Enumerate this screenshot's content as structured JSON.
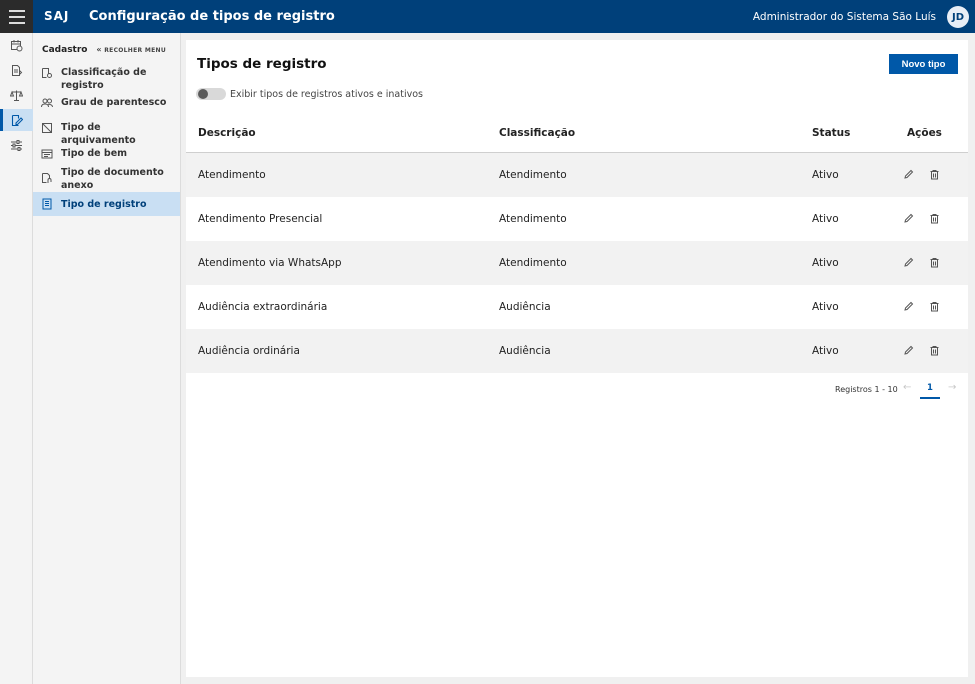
{
  "topbar": {
    "brand": "SAJ",
    "title": "Configuração de tipos de registro",
    "user_name": "Administrador do Sistema São Luís",
    "user_initials": "JD"
  },
  "rail": {
    "icons": [
      "calendar-clock-icon",
      "documents-icon",
      "scales-icon",
      "edit-document-icon",
      "sliders-icon"
    ],
    "active_index": 3
  },
  "sidemenu": {
    "header": "Cadastro",
    "collapse_label": "RECOLHER MENU",
    "items": [
      {
        "label": "Classificação de registro",
        "icon": "document-settings-icon"
      },
      {
        "label": "Grau de parentesco",
        "icon": "people-icon"
      },
      {
        "label": "Tipo de arquivamento",
        "icon": "archive-icon"
      },
      {
        "label": "Tipo de bem",
        "icon": "property-icon"
      },
      {
        "label": "Tipo de documento anexo",
        "icon": "document-attachment-icon"
      },
      {
        "label": "Tipo de registro",
        "icon": "document-list-icon"
      }
    ],
    "active_index": 5
  },
  "main": {
    "title": "Tipos de registro",
    "new_button": "Novo tipo",
    "toggle_label": "Exibir tipos de registros ativos e inativos",
    "toggle_on": false,
    "columns": {
      "description": "Descrição",
      "classification": "Classificação",
      "status": "Status",
      "actions": "Ações"
    },
    "rows": [
      {
        "description": "Atendimento",
        "classification": "Atendimento",
        "status": "Ativo"
      },
      {
        "description": "Atendimento Presencial",
        "classification": "Atendimento",
        "status": "Ativo"
      },
      {
        "description": "Atendimento via WhatsApp",
        "classification": "Atendimento",
        "status": "Ativo"
      },
      {
        "description": "Audiência extraordinária",
        "classification": "Audiência",
        "status": "Ativo"
      },
      {
        "description": "Audiência ordinária",
        "classification": "Audiência",
        "status": "Ativo"
      }
    ],
    "pagination": {
      "label": "Registros 1 - 10",
      "current_page": "1"
    }
  },
  "colors": {
    "topbar": "#00407a",
    "accent": "#0058a8",
    "active_menu": "#c9dff3"
  }
}
